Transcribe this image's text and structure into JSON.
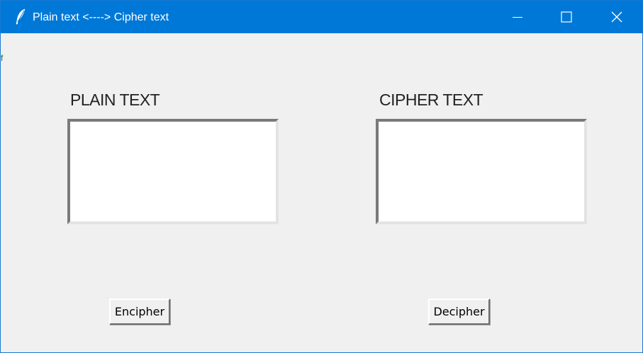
{
  "window": {
    "title": "Plain text <----> Cipher text",
    "app_icon": "feather-icon",
    "titlebar_color": "#0078d7",
    "controls": {
      "minimize_icon": "minimize-icon",
      "maximize_icon": "maximize-icon",
      "close_icon": "close-icon"
    }
  },
  "main": {
    "stray_text": "f",
    "plain": {
      "label": "PLAIN TEXT",
      "value": ""
    },
    "cipher": {
      "label": "CIPHER TEXT",
      "value": ""
    },
    "buttons": {
      "encipher_label": "Encipher",
      "decipher_label": "Decipher"
    }
  }
}
